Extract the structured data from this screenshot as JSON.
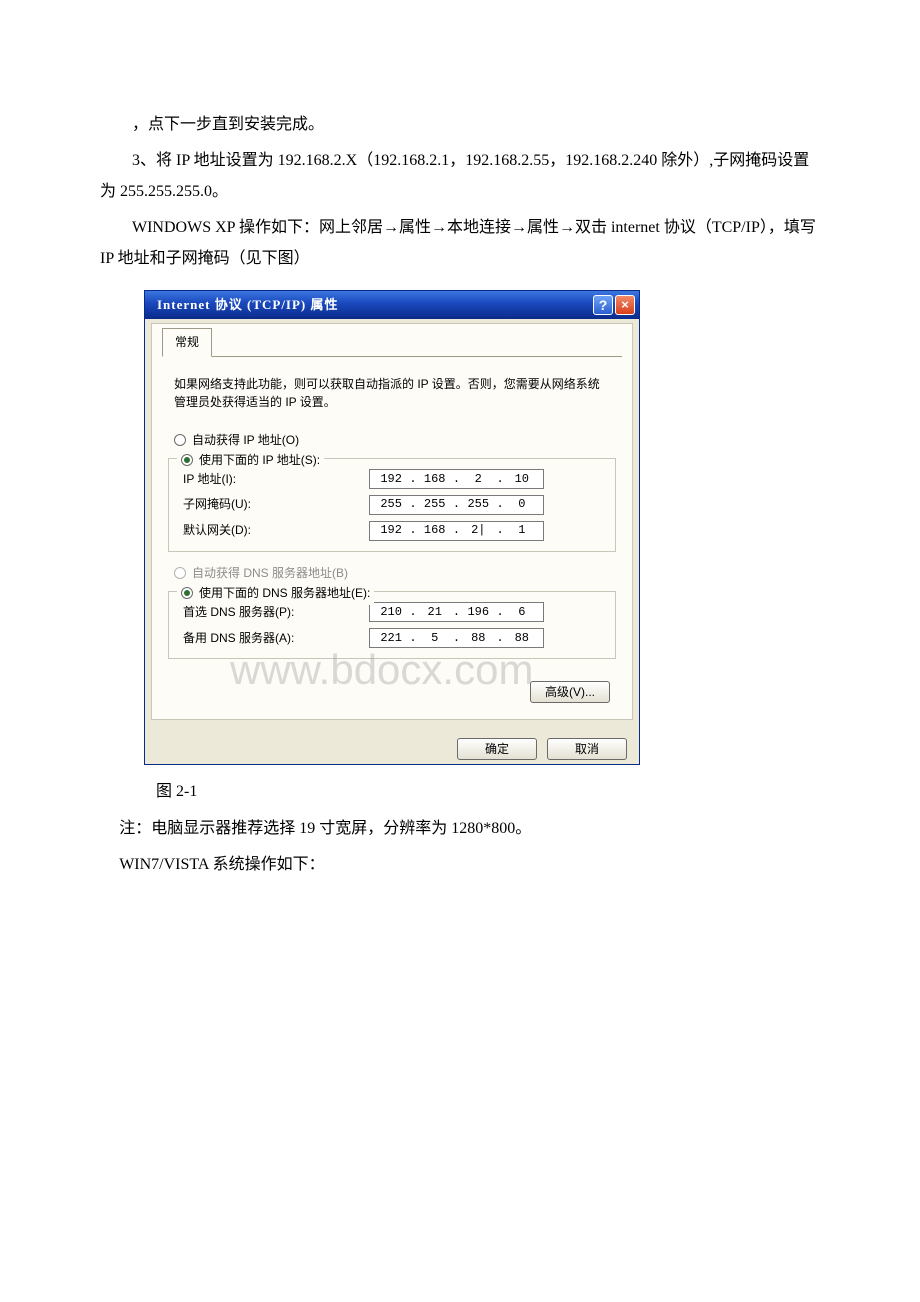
{
  "doc": {
    "p1": "，点下一步直到安装完成。",
    "p2": "3、将 IP 地址设置为 192.168.2.X（192.168.2.1，192.168.2.55，192.168.2.240 除外）,子网掩码设置为 255.255.255.0。",
    "p3": "WINDOWS XP 操作如下：网上邻居→属性→本地连接→属性→双击 internet 协议（TCP/IP），填写 IP 地址和子网掩码（见下图）",
    "caption": "图 2-1",
    "p4": "注：电脑显示器推荐选择 19 寸宽屏，分辨率为 1280*800。",
    "p5": "WIN7/VISTA 系统操作如下："
  },
  "dialog": {
    "title": "Internet 协议 (TCP/IP) 属性",
    "help": "?",
    "close": "×",
    "tab": "常规",
    "desc": "如果网络支持此功能，则可以获取自动指派的 IP 设置。否则，您需要从网络系统管理员处获得适当的 IP 设置。",
    "r1": "自动获得 IP 地址(O)",
    "r2": "使用下面的 IP 地址(S):",
    "ip_label": "IP 地址(I):",
    "mask_label": "子网掩码(U):",
    "gw_label": "默认网关(D):",
    "ip": [
      "192",
      "168",
      "2",
      "10"
    ],
    "mask": [
      "255",
      "255",
      "255",
      "0"
    ],
    "gw": [
      "192",
      "168",
      "2|",
      "1"
    ],
    "r3": "自动获得 DNS 服务器地址(B)",
    "r4": "使用下面的 DNS 服务器地址(E):",
    "dns1_label": "首选 DNS 服务器(P):",
    "dns2_label": "备用 DNS 服务器(A):",
    "dns1": [
      "210",
      "21",
      "196",
      "6"
    ],
    "dns2": [
      "221",
      "5",
      "88",
      "88"
    ],
    "advanced": "高级(V)...",
    "ok": "确定",
    "cancel": "取消"
  },
  "watermark": "www.bdocx.com"
}
